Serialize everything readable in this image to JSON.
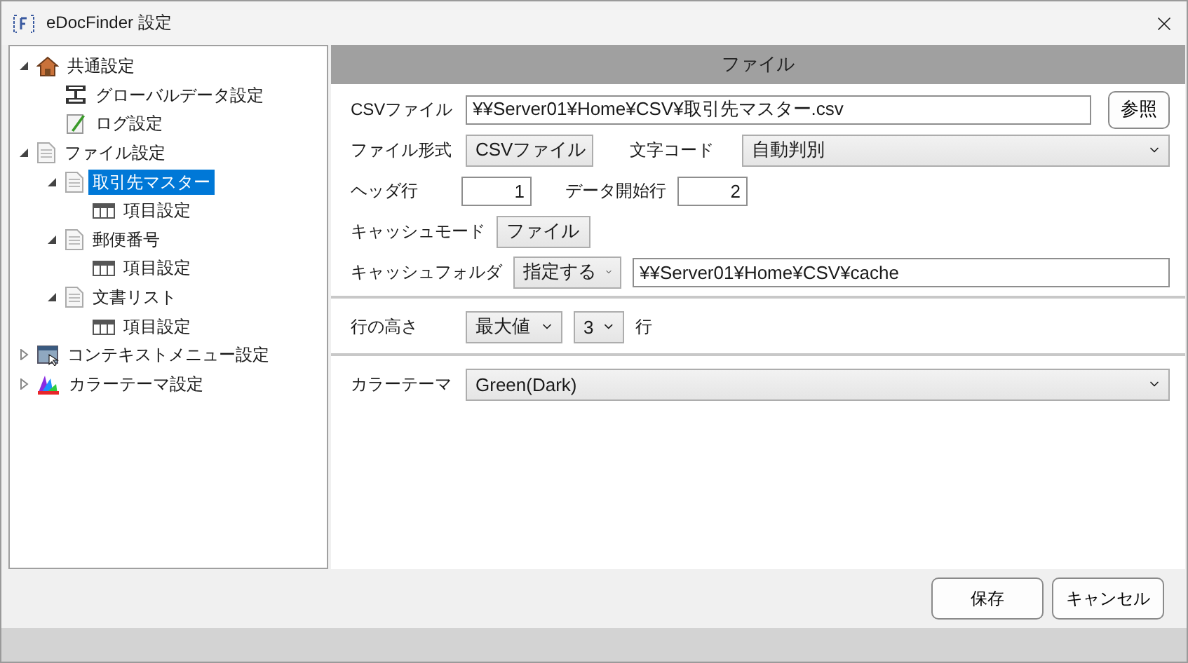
{
  "window": {
    "title": "eDocFinder 設定"
  },
  "tree": [
    {
      "label": "共通設定",
      "kind": "house",
      "expanded": true,
      "selected": false,
      "children": [
        {
          "label": "グローバルデータ設定",
          "kind": "server",
          "selected": false
        },
        {
          "label": "ログ設定",
          "kind": "note",
          "selected": false
        }
      ]
    },
    {
      "label": "ファイル設定",
      "kind": "document",
      "expanded": true,
      "selected": false,
      "children": [
        {
          "label": "取引先マスター",
          "kind": "document",
          "expanded": true,
          "selected": true,
          "children": [
            {
              "label": "項目設定",
              "kind": "grid",
              "selected": false
            }
          ]
        },
        {
          "label": "郵便番号",
          "kind": "document",
          "expanded": true,
          "selected": false,
          "children": [
            {
              "label": "項目設定",
              "kind": "grid",
              "selected": false
            }
          ]
        },
        {
          "label": "文書リスト",
          "kind": "document",
          "expanded": true,
          "selected": false,
          "children": [
            {
              "label": "項目設定",
              "kind": "grid",
              "selected": false
            }
          ]
        }
      ]
    },
    {
      "label": "コンテキストメニュー設定",
      "kind": "menu",
      "expanded": false,
      "selected": false
    },
    {
      "label": "カラーテーマ設定",
      "kind": "palette",
      "expanded": false,
      "selected": false
    }
  ],
  "panel": {
    "title": "ファイル"
  },
  "csv_file": {
    "label": "CSVファイル",
    "value": "¥¥Server01¥Home¥CSV¥取引先マスター.csv",
    "button": "参照"
  },
  "file_format": {
    "label": "ファイル形式",
    "value": "CSVファイル"
  },
  "encoding": {
    "label": "文字コード",
    "value": "自動判別"
  },
  "header_row": {
    "label": "ヘッダ行",
    "value": "1"
  },
  "data_start_row": {
    "label": "データ開始行",
    "value": "2"
  },
  "cache_mode": {
    "label": "キャッシュモード",
    "value": "ファイル"
  },
  "cache_folder": {
    "label": "キャッシュフォルダ",
    "mode": "指定する",
    "value": "¥¥Server01¥Home¥CSV¥cache"
  },
  "row_height": {
    "label": "行の高さ",
    "mode": "最大値",
    "value": "3",
    "unit": "行"
  },
  "color_theme": {
    "label": "カラーテーマ",
    "value": "Green(Dark)"
  },
  "buttons": [
    "保存",
    "キャンセル"
  ]
}
